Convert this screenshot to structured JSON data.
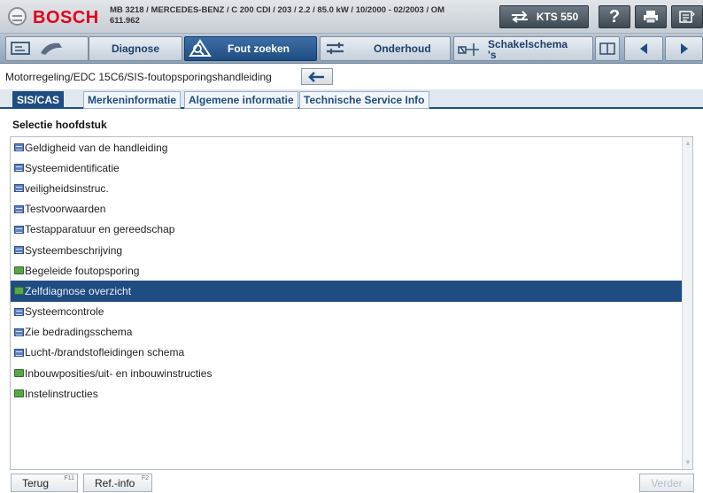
{
  "header": {
    "brand": "BOSCH",
    "vehicle_line": "MB 3218 / MERCEDES-BENZ / C 200 CDI / 203 / 2.2 / 85.0 kW / 10/2000 - 02/2003 / OM",
    "vehicle_code": "611.962",
    "kts_label": "KTS 550",
    "help_label": "?"
  },
  "nav": {
    "diagnose": "Diagnose",
    "fout_zoeken": "Fout zoeken",
    "onderhoud": "Onderhoud",
    "schakelschema": "Schakelschema",
    "schakelschema_suffix": "'s"
  },
  "breadcrumb": "Motorregeling/EDC 15C6/SIS-foutopsporingshandleiding",
  "subtabs": [
    "SIS/CAS",
    "Merkeninformatie",
    "Algemene informatie",
    "Technische Service Info"
  ],
  "section_title": "Selectie hoofdstuk",
  "list": [
    {
      "label": "Geldigheid van de handleiding",
      "icon": "doc-icon"
    },
    {
      "label": "Systeemidentificatie",
      "icon": "doc-icon"
    },
    {
      "label": "veiligheidsinstruc.",
      "icon": "doc-icon"
    },
    {
      "label": "Testvoorwaarden",
      "icon": "doc-icon"
    },
    {
      "label": "Testapparatuur en gereedschap",
      "icon": "doc-icon"
    },
    {
      "label": "Systeembeschrijving",
      "icon": "doc-icon"
    },
    {
      "label": "Begeleide foutopsporing",
      "icon": "folder-icon"
    },
    {
      "label": "Zelfdiagnose overzicht",
      "icon": "folder-icon",
      "selected": true
    },
    {
      "label": "Systeemcontrole",
      "icon": "doc-icon"
    },
    {
      "label": "Zie bedradingsschema",
      "icon": "doc-icon"
    },
    {
      "label": "Lucht-/brandstofleidingen schema",
      "icon": "doc-icon"
    },
    {
      "label": "Inbouwposities/uit- en inbouwinstructies",
      "icon": "folder-icon"
    },
    {
      "label": "Instelinstructies",
      "icon": "folder-icon"
    }
  ],
  "footer": {
    "back_label": "Terug",
    "back_key": "F11",
    "ref_label": "Ref.-info",
    "ref_key": "F2",
    "next_label": "Verder"
  },
  "colors": {
    "brand_red": "#e2001a",
    "selection_blue": "#1f4d82",
    "folder_green": "#5aa64a",
    "doc_blue": "#5e80c2"
  }
}
